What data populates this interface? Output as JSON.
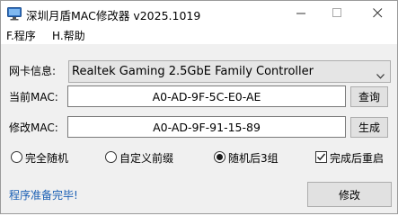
{
  "window": {
    "title": "深圳月盾MAC修改器 v2025.1019"
  },
  "menu": {
    "items": [
      "F.程序",
      "H.帮助"
    ]
  },
  "adapter": {
    "label": "网卡信息:",
    "selected": "Realtek Gaming 2.5GbE Family Controller"
  },
  "current_mac": {
    "label": "当前MAC:",
    "value": "A0-AD-9F-5C-E0-AE",
    "button": "查询"
  },
  "new_mac": {
    "label": "修改MAC:",
    "value": "A0-AD-9F-91-15-89",
    "button": "生成"
  },
  "options": {
    "full_random": {
      "label": "完全随机",
      "checked": false
    },
    "custom_prefix": {
      "label": "自定义前缀",
      "checked": false
    },
    "random_last3": {
      "label": "随机后3组",
      "checked": true
    },
    "restart_after": {
      "label": "完成后重启",
      "checked": true
    }
  },
  "status": {
    "text": "程序准备完毕!",
    "color": "#1a5fb4"
  },
  "actions": {
    "modify": "修改"
  },
  "icons": {
    "app": "monitor-icon",
    "minimize": "minimize-icon",
    "maximize": "maximize-icon",
    "close": "close-icon",
    "dropdown": "chevron-down-icon"
  }
}
